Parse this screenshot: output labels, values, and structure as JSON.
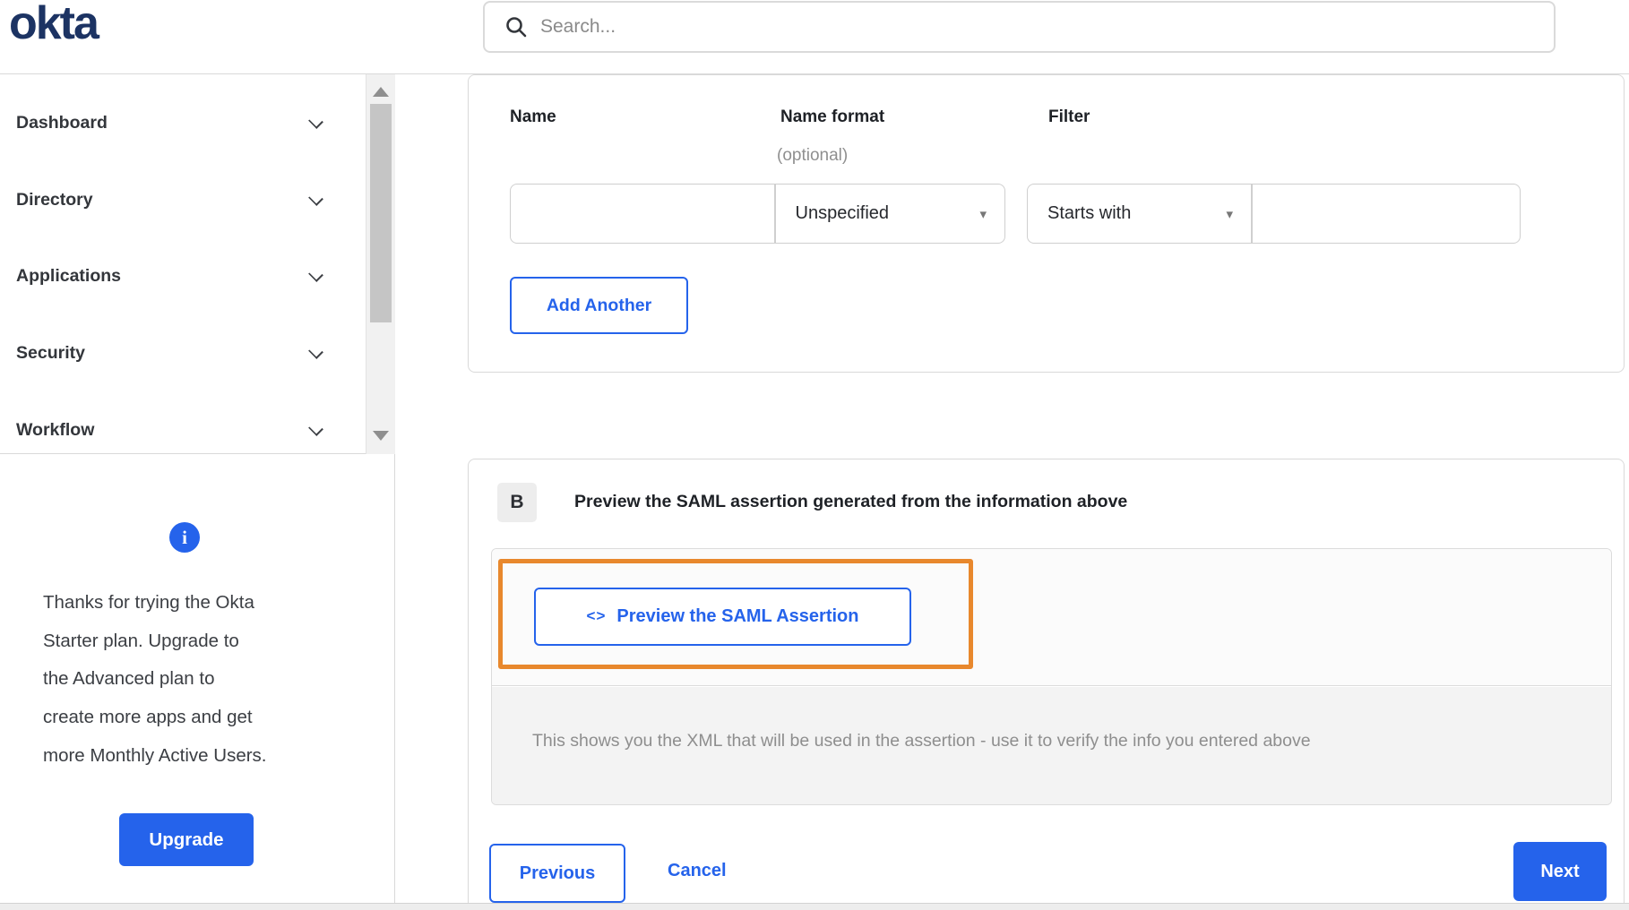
{
  "colors": {
    "primary_blue": "#2563eb",
    "logo_navy": "#1c3363",
    "annotation_orange": "#e8882d"
  },
  "header": {
    "logo_text": "okta",
    "search_placeholder": "Search..."
  },
  "sidebar": {
    "items": [
      {
        "label": "Dashboard"
      },
      {
        "label": "Directory"
      },
      {
        "label": "Applications"
      },
      {
        "label": "Security"
      },
      {
        "label": "Workflow"
      }
    ],
    "trial_notice_lines": [
      "Thanks for trying the Okta",
      "Starter plan. Upgrade to",
      "the Advanced plan to",
      "create more apps and get",
      "more Monthly Active Users."
    ],
    "upgrade_button_label": "Upgrade"
  },
  "attribute_statements_form": {
    "name_label": "Name",
    "name_format_label": "Name format",
    "name_format_hint": "(optional)",
    "filter_label": "Filter",
    "name_value": "",
    "name_format_value": "Unspecified",
    "filter_type_value": "Starts with",
    "filter_value": "",
    "add_another_button_label": "Add Another"
  },
  "preview_section": {
    "step_badge": "B",
    "heading": "Preview the SAML assertion generated from the information above",
    "preview_button_icon": "<>",
    "preview_button_label": "Preview the SAML Assertion",
    "description": "This shows you the XML that will be used in the assertion - use it to verify the info you entered above"
  },
  "wizard_footer": {
    "previous_label": "Previous",
    "cancel_label": "Cancel",
    "next_label": "Next"
  },
  "icons": {
    "info": "i",
    "dropdown_caret": "▾"
  }
}
